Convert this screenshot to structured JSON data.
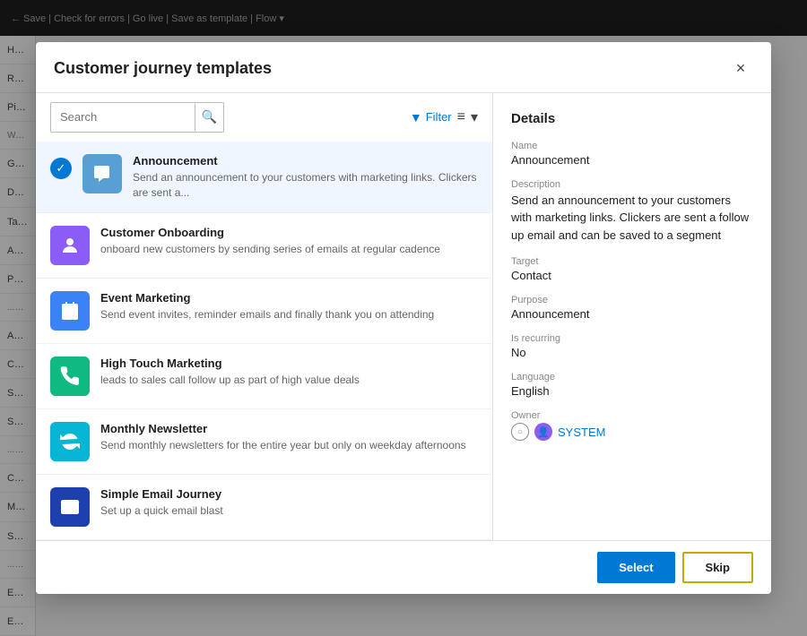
{
  "modal": {
    "title": "Customer journey templates",
    "close_label": "×"
  },
  "search": {
    "placeholder": "Search",
    "value": ""
  },
  "filter": {
    "label": "Filter",
    "icon": "▾"
  },
  "toolbar": {
    "back_label": "←",
    "save_label": "Save",
    "check_errors_label": "Check for errors",
    "go_live_label": "Go live",
    "save_as_template_label": "Save as template",
    "flow_label": "Flow"
  },
  "templates": [
    {
      "id": "announcement",
      "name": "Announcement",
      "description": "Send an announcement to your customers with marketing links. Clickers are sent a...",
      "icon_color": "#5a9fd4",
      "icon_unicode": "📢",
      "selected": true
    },
    {
      "id": "customer-onboarding",
      "name": "Customer Onboarding",
      "description": "onboard new customers by sending series of emails at regular cadence",
      "icon_color": "#8b5cf6",
      "icon_unicode": "👤",
      "selected": false
    },
    {
      "id": "event-marketing",
      "name": "Event Marketing",
      "description": "Send event invites, reminder emails and finally thank you on attending",
      "icon_color": "#3b82f6",
      "icon_unicode": "📅",
      "selected": false
    },
    {
      "id": "high-touch-marketing",
      "name": "High Touch Marketing",
      "description": "leads to sales call follow up as part of high value deals",
      "icon_color": "#10b981",
      "icon_unicode": "📞",
      "selected": false
    },
    {
      "id": "monthly-newsletter",
      "name": "Monthly Newsletter",
      "description": "Send monthly newsletters for the entire year but only on weekday afternoons",
      "icon_color": "#06b6d4",
      "icon_unicode": "🔄",
      "selected": false
    },
    {
      "id": "simple-email-journey",
      "name": "Simple Email Journey",
      "description": "Set up a quick email blast",
      "icon_color": "#1e40af",
      "icon_unicode": "✉",
      "selected": false
    }
  ],
  "details": {
    "section_title": "Details",
    "name_label": "Name",
    "name_value": "Announcement",
    "description_label": "Description",
    "description_value": "Send an announcement to your customers with marketing links. Clickers are sent a follow up email and can be saved to a segment",
    "target_label": "Target",
    "target_value": "Contact",
    "purpose_label": "Purpose",
    "purpose_value": "Announcement",
    "is_recurring_label": "Is recurring",
    "is_recurring_value": "No",
    "language_label": "Language",
    "language_value": "English",
    "owner_label": "Owner",
    "owner_value": "SYSTEM"
  },
  "footer": {
    "select_label": "Select",
    "skip_label": "Skip"
  },
  "sidebar": {
    "items": [
      "Home",
      "Recent",
      "Pinned",
      "Work",
      "Get start...",
      "Dashbo...",
      "Tasks",
      "Appoint...",
      "Phone C...",
      "...mers",
      "Account",
      "Contacts",
      "Segment",
      "Subscri...",
      "...eting ex",
      "Custome...",
      "Marketi...",
      "Social p...",
      "...manag",
      "Events",
      "Event Re..."
    ]
  },
  "colors": {
    "primary": "#0078d4",
    "skip_border": "#c8a800"
  }
}
